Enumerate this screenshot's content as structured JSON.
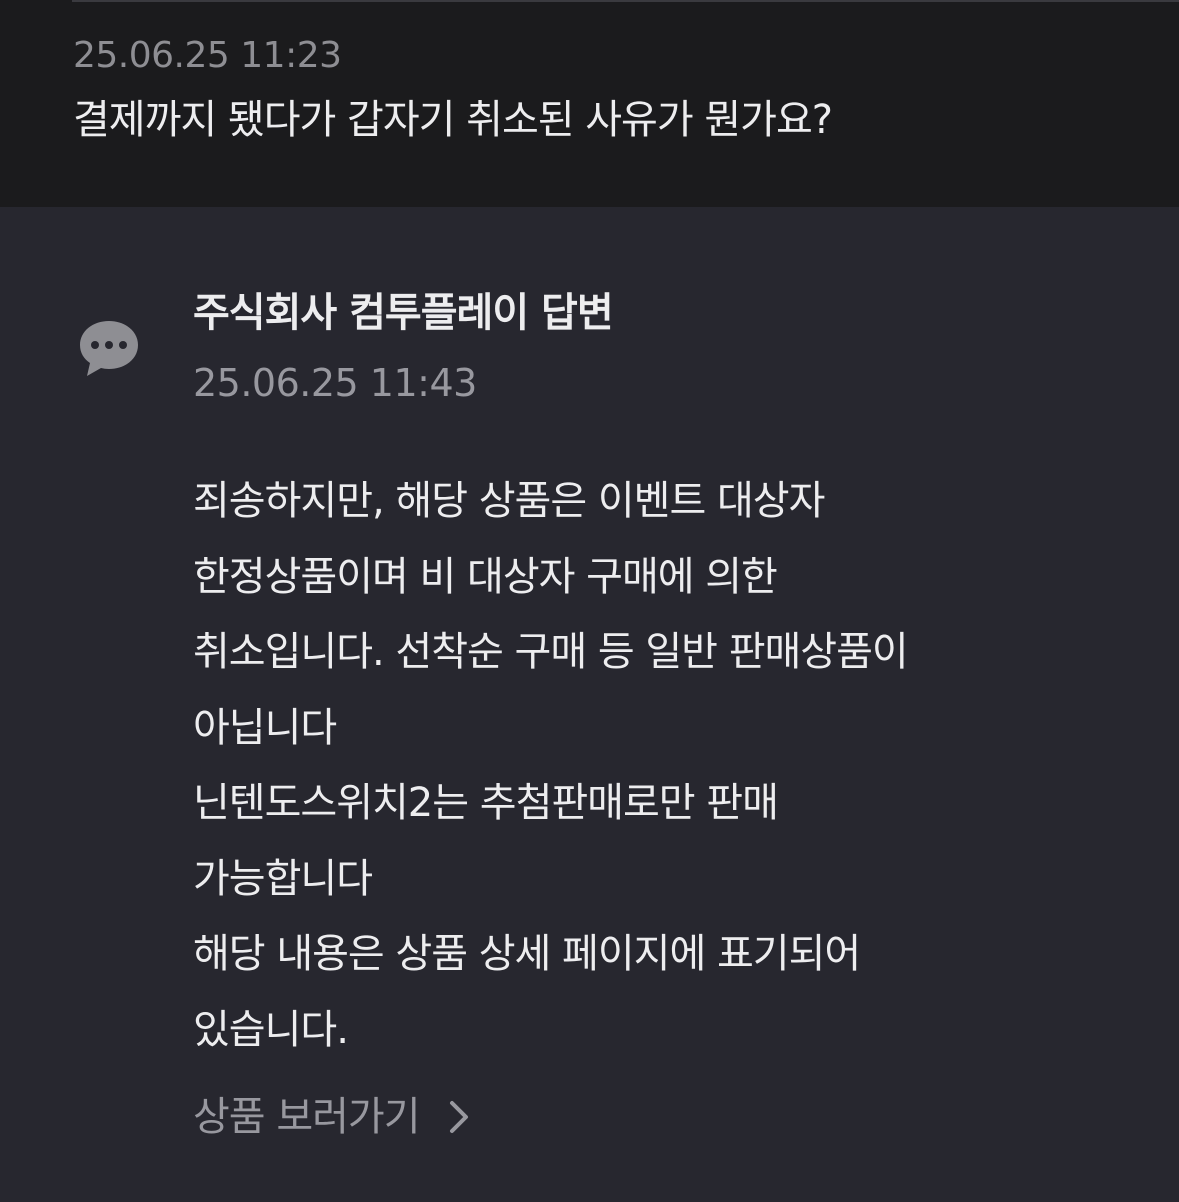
{
  "question": {
    "timestamp": "25.06.25 11:23",
    "text": "결제까지 됐다가 갑자기 취소된 사유가 뭔가요?"
  },
  "answer": {
    "icon": "chat-bubble-icon",
    "title": "주식회사 컴투플레이 답변",
    "timestamp": "25.06.25 11:43",
    "lines": [
      "죄송하지만, 해당 상품은 이벤트 대상자",
      "한정상품이며 비 대상자 구매에 의한",
      "취소입니다. 선착순 구매 등 일반 판매상품이",
      "아닙니다",
      "닌텐도스위치2는 추첨판매로만 판매",
      "가능합니다",
      "해당 내용은 상품 상세 페이지에 표기되어",
      "있습니다."
    ],
    "link_label": "상품 보러가기",
    "link_icon": "chevron-right-icon"
  },
  "colors": {
    "question_bg": "#1b1b1d",
    "answer_bg": "#27272f",
    "primary_text": "#ededef",
    "secondary_text": "#98989f"
  }
}
